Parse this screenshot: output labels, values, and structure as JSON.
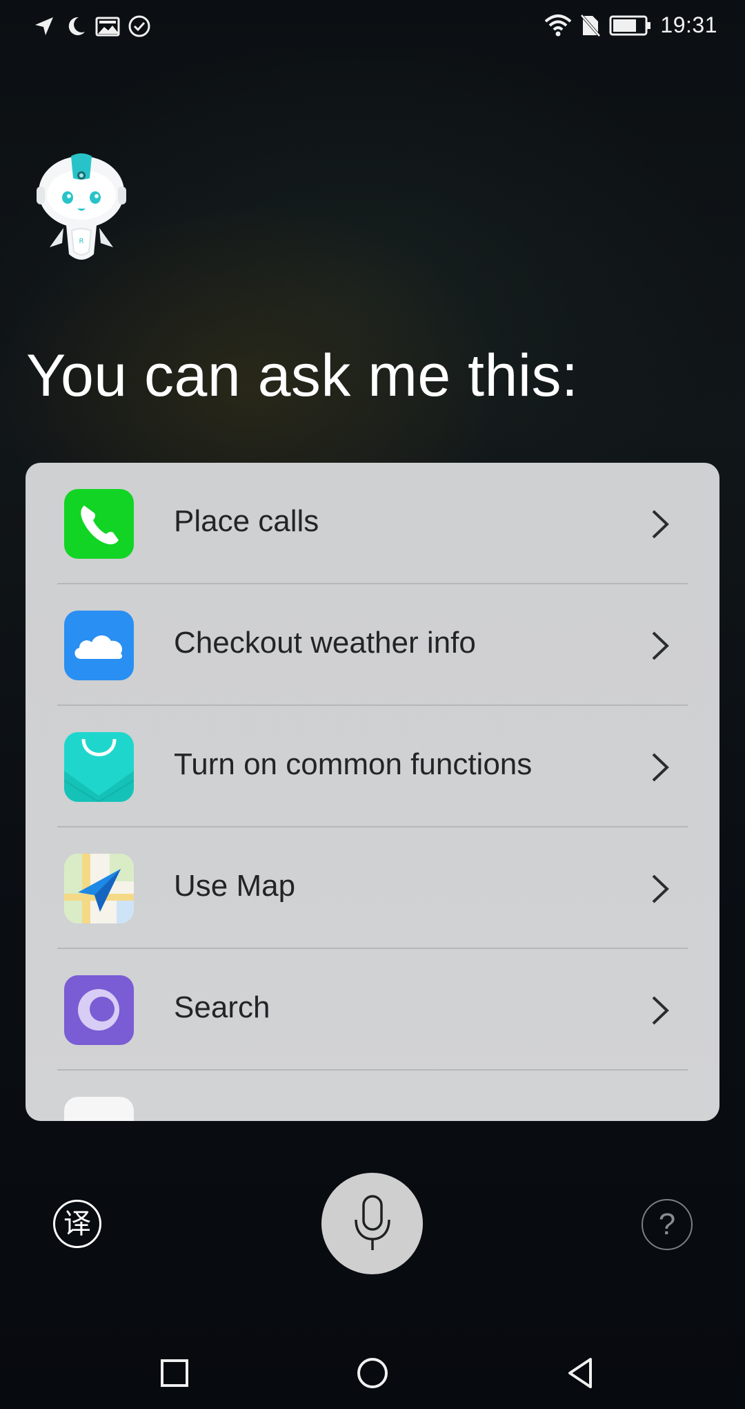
{
  "status_bar": {
    "time": "19:31",
    "left_icons": [
      "location-icon",
      "moon-icon",
      "gallery-icon",
      "check-circle-icon"
    ],
    "right_icons": [
      "wifi-icon",
      "no-sim-icon",
      "battery-icon"
    ],
    "battery_level": 0.75
  },
  "heading": "You can ask me this:",
  "suggestions": [
    {
      "label": "Place calls",
      "icon": "phone-icon",
      "color": "#12d424"
    },
    {
      "label": "Checkout weather info",
      "icon": "weather-cloud-icon",
      "color": "#2a8ff2"
    },
    {
      "label": "Turn on common functions",
      "icon": "shopping-bag-icon",
      "color": "#1fd6cc"
    },
    {
      "label": "Use Map",
      "icon": "map-icon",
      "color": "#1e88e5"
    },
    {
      "label": "Search",
      "icon": "search-ring-icon",
      "color": "#7a5cd4"
    }
  ],
  "controls": {
    "translate_glyph": "译",
    "help_glyph": "?"
  }
}
